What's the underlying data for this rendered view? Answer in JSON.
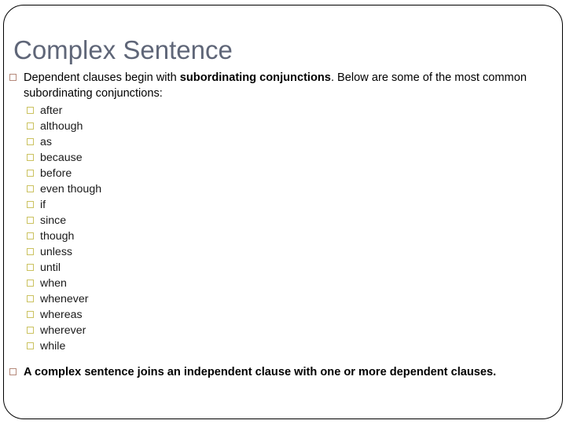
{
  "slide": {
    "title": "Complex Sentence",
    "title_color": "#5f6678",
    "border_color": "#000000",
    "background_color": "#ffffff",
    "level1_bullet_color": "#b5897a",
    "level2_bullet_color": "#cbc260",
    "bullet_glyph": "hollow-square"
  },
  "intro": {
    "lead": "Dependent clauses begin with ",
    "emphasis": "subordinating conjunctions",
    "tail": ". Below are some of the most common subordinating conjunctions:"
  },
  "conjunctions": [
    {
      "label": "after"
    },
    {
      "label": "although"
    },
    {
      "label": "as"
    },
    {
      "label": "because"
    },
    {
      "label": "before"
    },
    {
      "label": "even though"
    },
    {
      "label": "if"
    },
    {
      "label": "since"
    },
    {
      "label": "though"
    },
    {
      "label": "unless"
    },
    {
      "label": "until"
    },
    {
      "label": "when"
    },
    {
      "label": "whenever"
    },
    {
      "label": "whereas"
    },
    {
      "label": "wherever"
    },
    {
      "label": "while"
    }
  ],
  "conclusion": {
    "text": "A complex sentence joins an independent clause with one or more dependent clauses."
  }
}
